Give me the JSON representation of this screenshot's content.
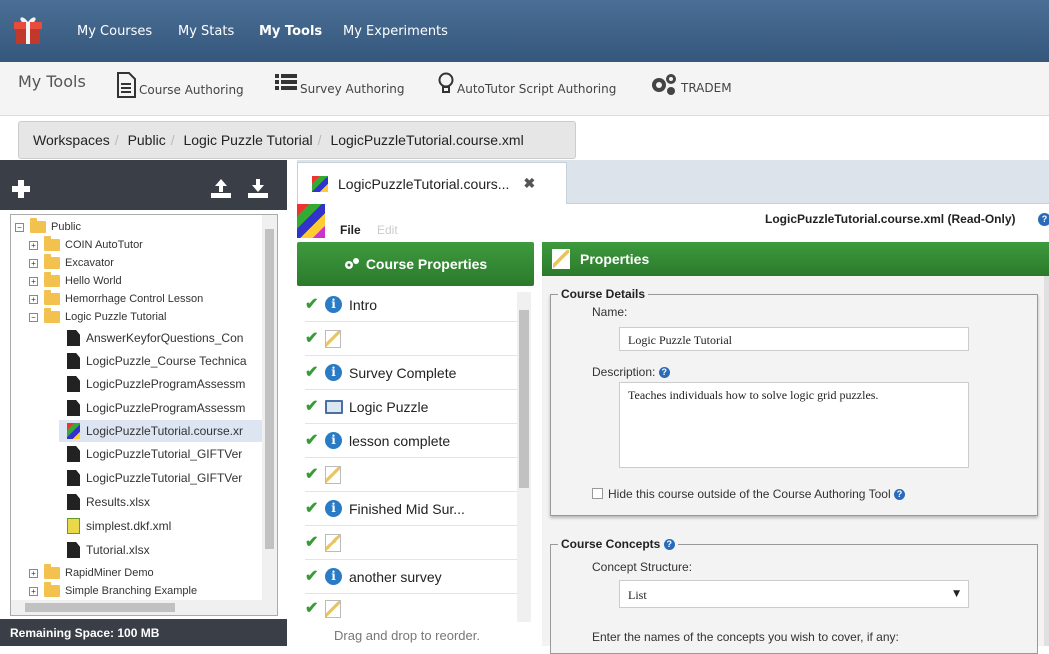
{
  "topnav": {
    "items": [
      "My Courses",
      "My Stats",
      "My Tools",
      "My Experiments"
    ],
    "active": "My Tools"
  },
  "toolsbar": {
    "title": "My Tools",
    "tools": [
      "Course Authoring",
      "Survey Authoring",
      "AutoTutor Script Authoring",
      "TRADEM"
    ]
  },
  "breadcrumb": [
    "Workspaces",
    "Public",
    "Logic Puzzle Tutorial",
    "LogicPuzzleTutorial.course.xml"
  ],
  "tree": {
    "root": "Public",
    "folders": [
      "COIN AutoTutor",
      "Excavator",
      "Hello World",
      "Hemorrhage Control Lesson",
      "Logic Puzzle Tutorial"
    ],
    "files": [
      "AnswerKeyforQuestions_Con",
      "LogicPuzzle_Course Technica",
      "LogicPuzzleProgramAssessm",
      "LogicPuzzleProgramAssessm",
      "LogicPuzzleTutorial.course.xr",
      "LogicPuzzleTutorial_GIFTVer",
      "LogicPuzzleTutorial_GIFTVer",
      "Results.xlsx",
      "simplest.dkf.xml",
      "Tutorial.xlsx"
    ],
    "trailing_folders": [
      "RapidMiner Demo",
      "Simple Branching Example"
    ]
  },
  "left_footer": "Remaining Space: 100 MB",
  "editor": {
    "tab_label": "LogicPuzzleTutorial.cours...",
    "menu_file": "File",
    "menu_edit": "Edit",
    "file_status": "LogicPuzzleTutorial.course.xml (Read-Only)"
  },
  "course_properties": {
    "button": "Course Properties",
    "items": [
      {
        "label": "Intro",
        "icon": "info-icon"
      },
      {
        "label": "",
        "icon": "pencil-icon"
      },
      {
        "label": "Survey Complete",
        "icon": "info-icon"
      },
      {
        "label": "Logic Puzzle",
        "icon": "monitor-icon"
      },
      {
        "label": "lesson complete",
        "icon": "info-icon"
      },
      {
        "label": "",
        "icon": "pencil-icon"
      },
      {
        "label": "Finished Mid Sur...",
        "icon": "info-icon"
      },
      {
        "label": "",
        "icon": "pencil-icon"
      },
      {
        "label": "another survey",
        "icon": "info-icon"
      },
      {
        "label": "",
        "icon": "pencil-icon"
      }
    ],
    "drag_note": "Drag and drop to reorder."
  },
  "properties": {
    "header": "Properties",
    "details_legend": "Course Details",
    "name_label": "Name:",
    "name_value": "Logic Puzzle Tutorial",
    "description_label": "Description:",
    "description_value": "Teaches individuals how to solve logic grid puzzles.",
    "hide_label": "Hide this course outside of the Course Authoring Tool",
    "concepts_legend": "Course Concepts",
    "structure_label": "Concept Structure:",
    "structure_value": "List",
    "concepts_hint": "Enter the names of the concepts you wish to cover, if any:"
  },
  "colors": {
    "nav": "#3e6288",
    "green": "#338833",
    "dark_panel": "#3a3f47"
  }
}
